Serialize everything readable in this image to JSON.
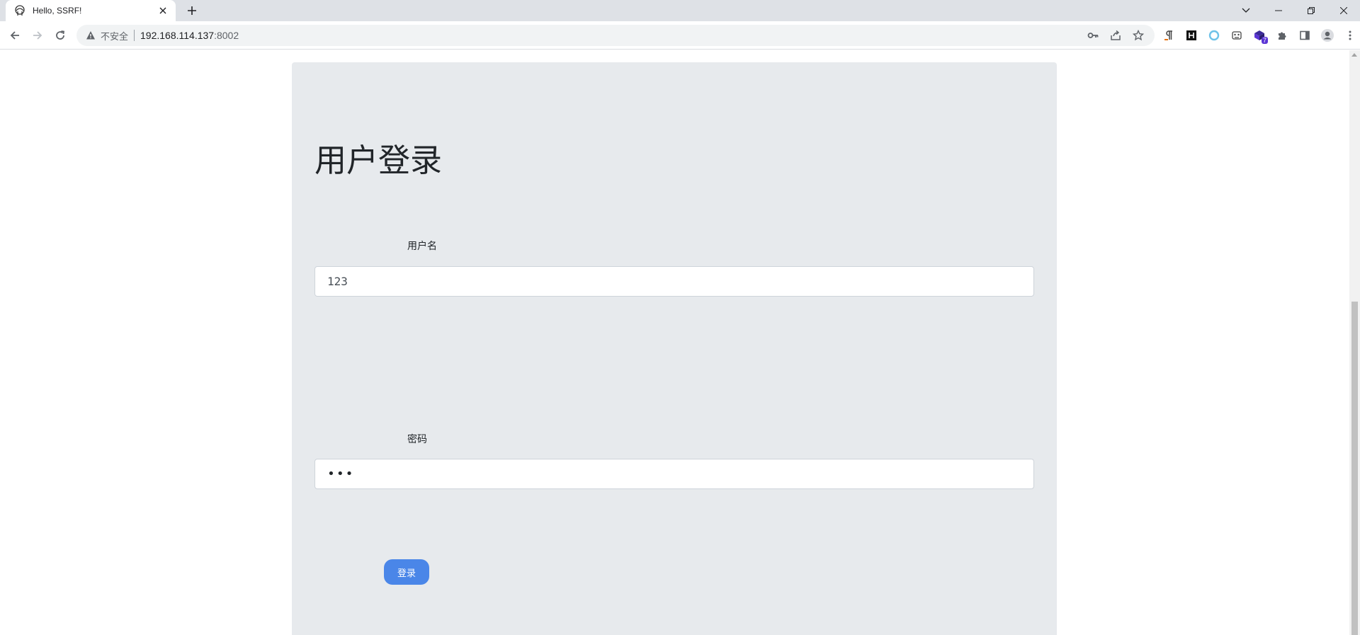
{
  "browser": {
    "tab": {
      "title": "Hello, SSRF!",
      "favicon": "anime-girl-favicon"
    },
    "address": {
      "security_label": "不安全",
      "host": "192.168.114.137",
      "port": ":8002"
    },
    "extensions": [
      {
        "name": "paragraph-ext-icon"
      },
      {
        "name": "hackbar-ext-icon"
      },
      {
        "name": "ring-ext-icon"
      },
      {
        "name": "panda-ext-icon"
      },
      {
        "name": "cube-ext-icon",
        "badge": "7"
      },
      {
        "name": "puzzle-icon"
      },
      {
        "name": "sidepanel-icon"
      },
      {
        "name": "profile-avatar-icon"
      },
      {
        "name": "kebab-menu-icon"
      }
    ]
  },
  "page": {
    "heading": "用户登录",
    "username": {
      "label": "用户名",
      "value": "123"
    },
    "password": {
      "label": "密码",
      "value": "•••"
    },
    "submit_label": "登录"
  },
  "colors": {
    "card_bg": "#e7eaed",
    "button_bg": "#4a86e8"
  }
}
